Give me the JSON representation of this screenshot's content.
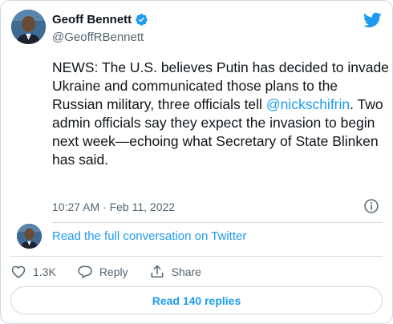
{
  "author": {
    "name": "Geoff Bennett",
    "handle": "@GeoffRBennett"
  },
  "tweet": {
    "text_before": "NEWS: The U.S. believes Putin has decided to invade Ukraine and communicated those plans to the Russian military, three officials tell ",
    "mention": "@nickschifrin",
    "text_after": ". Two admin officials say they expect the invasion to begin next week—echoing what Secretary of State Blinken has said.",
    "timestamp": "10:27 AM · Feb 11, 2022"
  },
  "conversation": {
    "link_label": "Read the full conversation on Twitter"
  },
  "actions": {
    "like_count": "1.3K",
    "reply_label": "Reply",
    "share_label": "Share"
  },
  "read_replies_label": "Read 140 replies",
  "colors": {
    "accent": "#1d9bf0",
    "like_red": "#536471",
    "text": "#0f1419",
    "muted": "#536471",
    "border": "#cfd9de"
  },
  "icons": {
    "verified": "verified-badge-icon",
    "brand": "twitter-bird-icon",
    "info": "info-icon",
    "like": "heart-icon",
    "reply": "speech-bubble-icon",
    "share": "share-arrow-icon"
  }
}
